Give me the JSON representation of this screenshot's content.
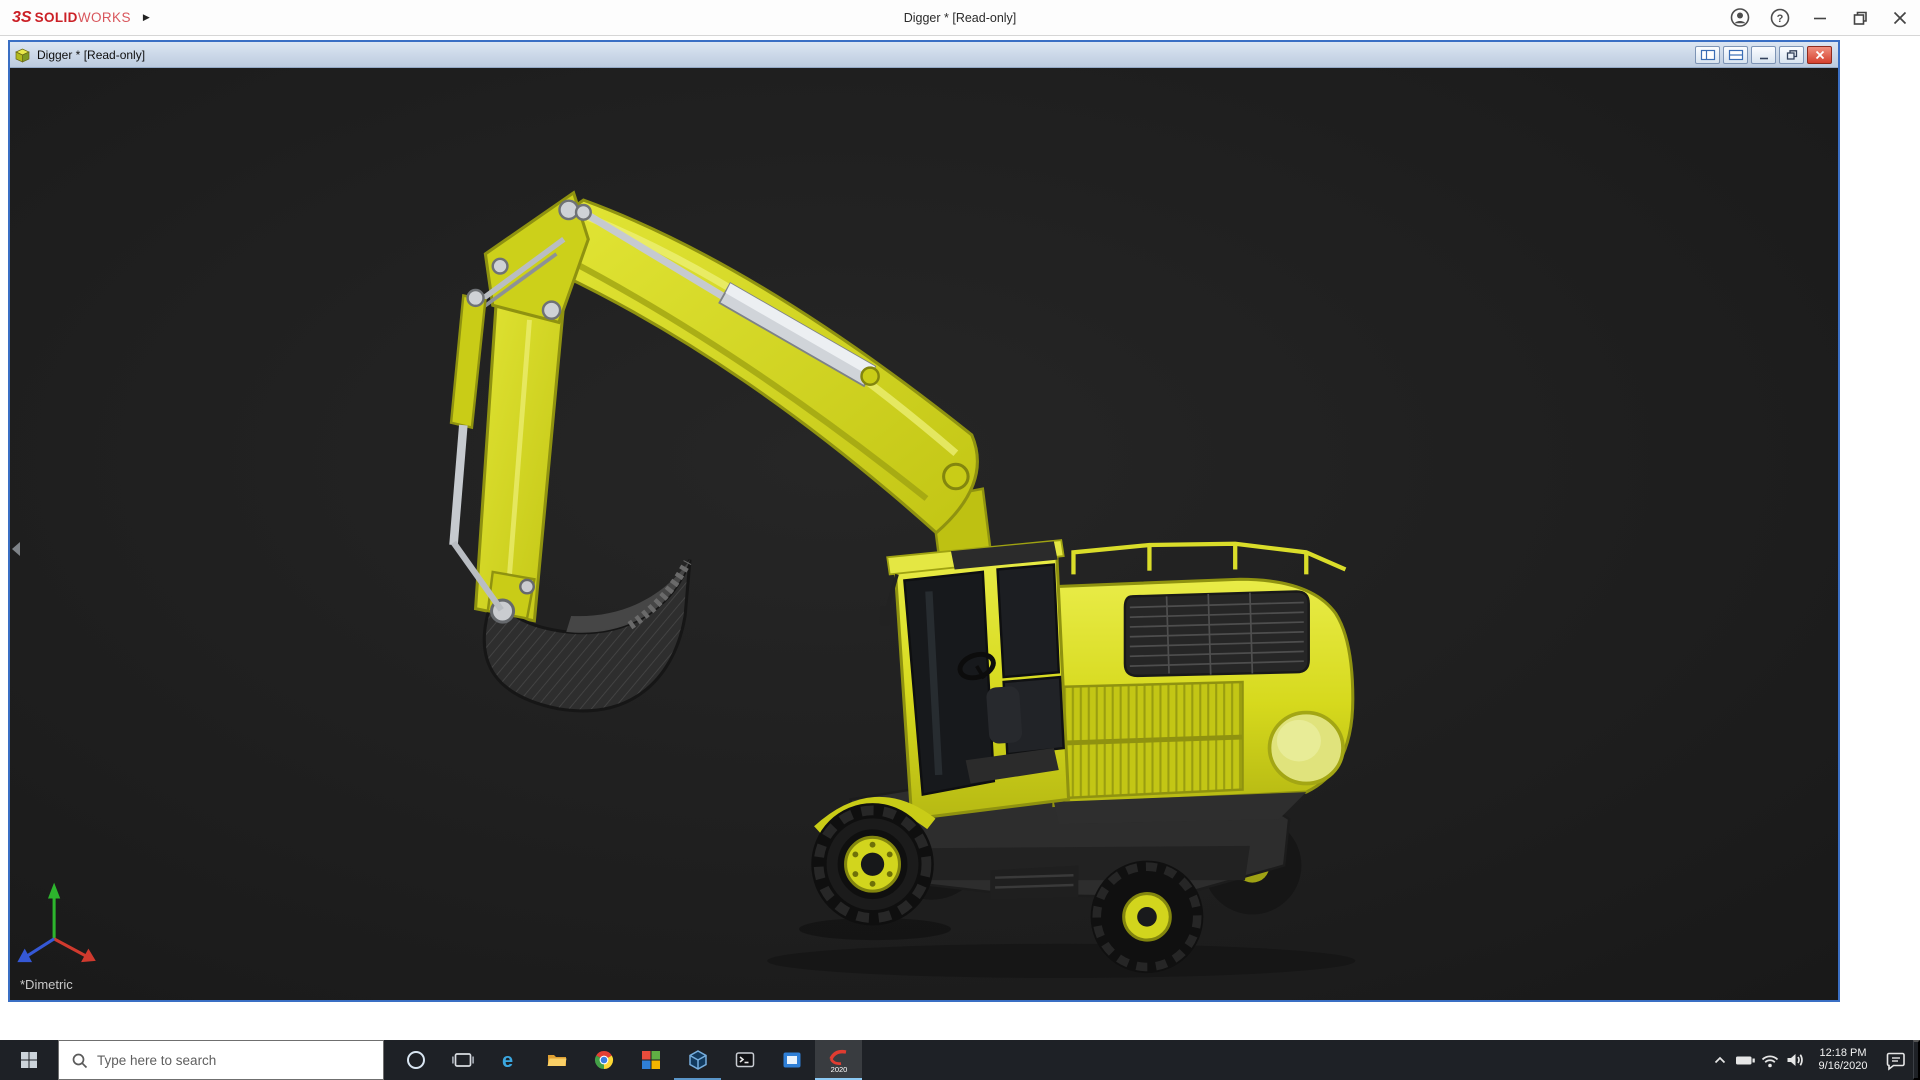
{
  "app": {
    "logo": {
      "mark": "3S",
      "word_bold": "SOLID",
      "word_light": "WORKS"
    },
    "title": "Digger * [Read-only]"
  },
  "doc_window": {
    "title": "Digger * [Read-only]",
    "view_orientation": "*Dimetric"
  },
  "taskbar": {
    "search_placeholder": "Type here to search",
    "sw_year_badge": "2020",
    "clock": {
      "time": "12:18 PM",
      "date": "9/16/2020"
    }
  },
  "icons": {
    "flyout_glyph": "▶",
    "help_glyph": "?",
    "edge_glyph": "e"
  },
  "colors": {
    "digger_yellow": "#d6d91d",
    "digger_dark_gray": "#2e2e2e",
    "viewport_background": "#1f1f1f",
    "child_window_border": "#3a6fc4",
    "close_button_red": "#d5412f",
    "taskbar_background": "#1e2126",
    "taskbar_active_underline": "#8ccaf5"
  }
}
